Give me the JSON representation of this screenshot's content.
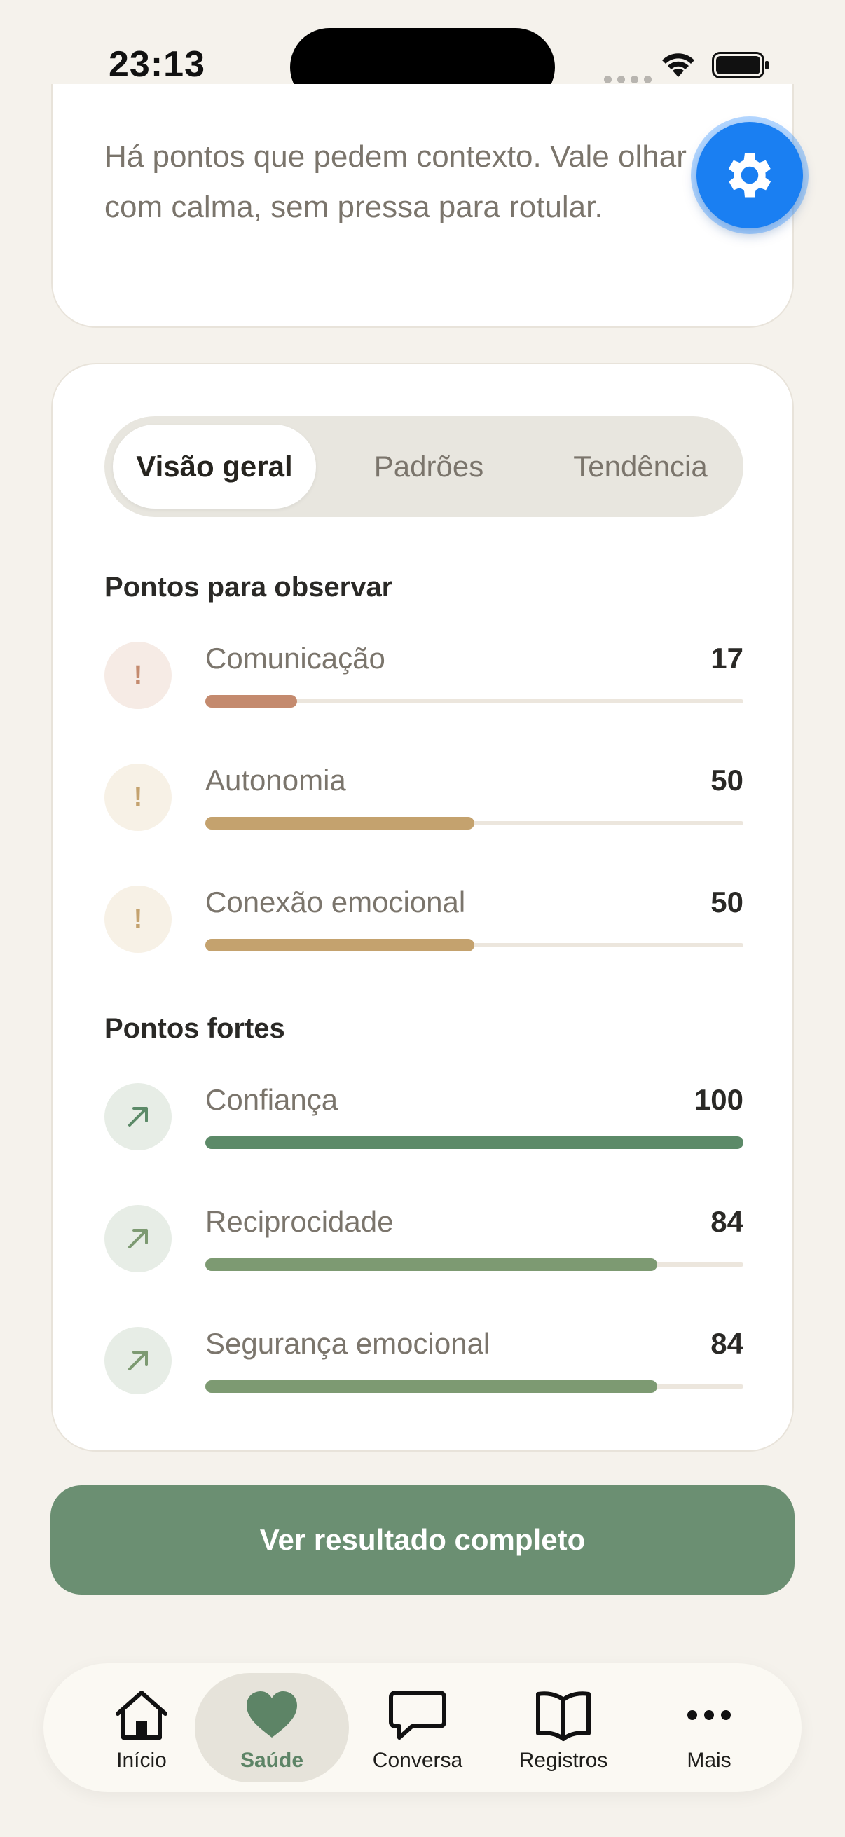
{
  "status_bar": {
    "time": "23:13"
  },
  "top_card": {
    "text": "Há pontos que pedem contexto. Vale olhar com calma, sem pressa para rotular."
  },
  "fab": {
    "icon": "gear-icon",
    "color": "#1a7ff2"
  },
  "tabs": [
    {
      "label": "Visão geral",
      "active": true
    },
    {
      "label": "Padrões",
      "active": false
    },
    {
      "label": "Tendência",
      "active": false
    }
  ],
  "observe_section": {
    "title": "Pontos para observar",
    "items": [
      {
        "label": "Comunicação",
        "value": "17",
        "fraction": 0.17,
        "icon": "exclamation-icon",
        "color": "#c48a6e",
        "icon_bg": "#f6ebe5"
      },
      {
        "label": "Autonomia",
        "value": "50",
        "fraction": 0.5,
        "icon": "exclamation-icon",
        "color": "#c4a26e",
        "icon_bg": "#f7f1e6"
      },
      {
        "label": "Conexão emocional",
        "value": "50",
        "fraction": 0.5,
        "icon": "exclamation-icon",
        "color": "#c4a26e",
        "icon_bg": "#f7f1e6"
      }
    ]
  },
  "strengths_section": {
    "title": "Pontos fortes",
    "items": [
      {
        "label": "Confiança",
        "value": "100",
        "fraction": 1.0,
        "icon": "arrow-up-right-icon",
        "color": "#5c8a68",
        "icon_bg": "#e7ede6"
      },
      {
        "label": "Reciprocidade",
        "value": "84",
        "fraction": 0.84,
        "icon": "arrow-up-right-icon",
        "color": "#7d9a72",
        "icon_bg": "#e7ede6"
      },
      {
        "label": "Segurança emocional",
        "value": "84",
        "fraction": 0.84,
        "icon": "arrow-up-right-icon",
        "color": "#7d9a72",
        "icon_bg": "#e7ede6"
      }
    ]
  },
  "cta": {
    "label": "Ver resultado completo",
    "color": "#6b8f72"
  },
  "bottom_nav": [
    {
      "label": "Início",
      "icon": "home-icon",
      "active": false
    },
    {
      "label": "Saúde",
      "icon": "heart-icon",
      "active": true
    },
    {
      "label": "Conversa",
      "icon": "chat-bubble-icon",
      "active": false
    },
    {
      "label": "Registros",
      "icon": "book-icon",
      "active": false
    },
    {
      "label": "Mais",
      "icon": "more-dots-icon",
      "active": false
    }
  ]
}
